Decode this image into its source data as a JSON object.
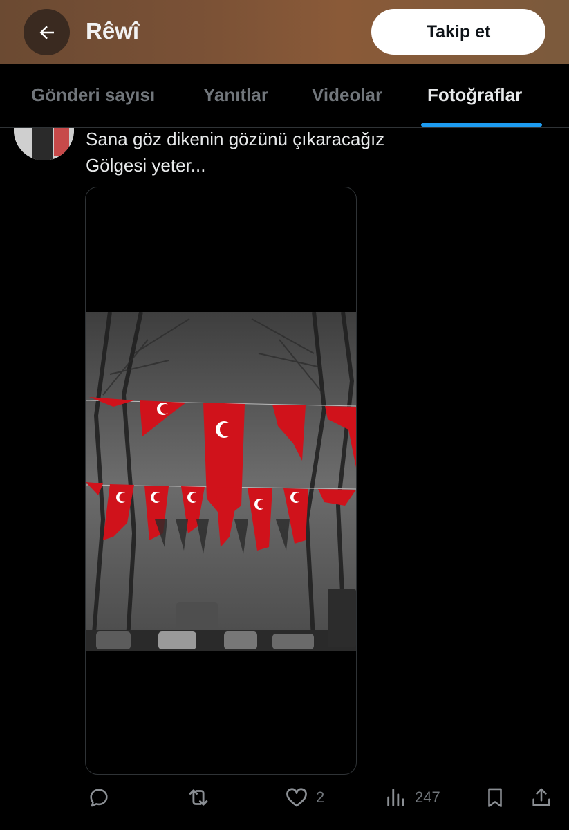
{
  "header": {
    "title": "Rêwî",
    "follow_label": "Takip et"
  },
  "tabs": [
    {
      "label": "Gönderi sayısı",
      "active": false
    },
    {
      "label": "Yanıtlar",
      "active": false
    },
    {
      "label": "Videolar",
      "active": false
    },
    {
      "label": "Fotoğraflar",
      "active": true
    }
  ],
  "post": {
    "text_line1": "Sana göz dikenin gözünü çıkaracağız",
    "text_line2": "Gölgesi yeter...",
    "likes": "2",
    "views": "247"
  },
  "icons": [
    "back-arrow-icon",
    "reply-icon",
    "repost-icon",
    "like-icon",
    "views-icon",
    "bookmark-icon",
    "share-icon"
  ],
  "colors": {
    "accent": "#1d9bf0",
    "flag_red": "#d0121b",
    "muted": "#71767b"
  }
}
